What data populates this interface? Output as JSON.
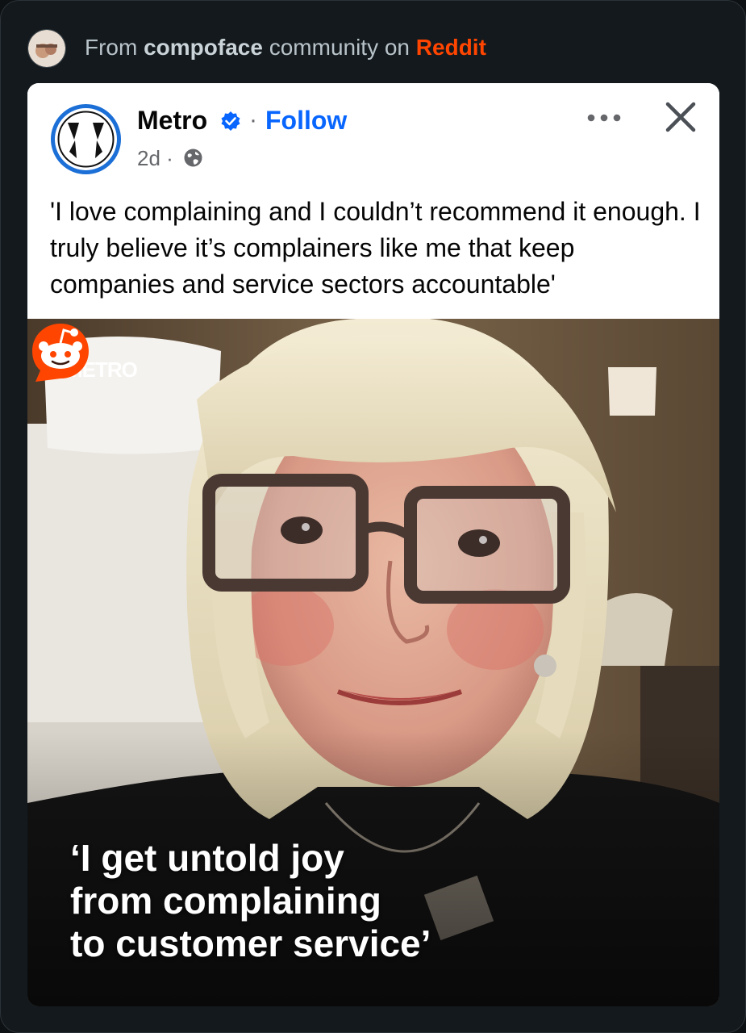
{
  "source": {
    "prefix": "From",
    "community": "compoface",
    "middle": "community on",
    "platform": "Reddit",
    "colors": {
      "platform": "#ff4500"
    }
  },
  "post": {
    "page_name": "Metro",
    "separator": "·",
    "follow_label": "Follow",
    "time": "2d ·",
    "icons": [
      "metro-logo",
      "verified-badge-icon",
      "globe-icon",
      "more-options-icon",
      "close-icon"
    ],
    "caption": "'I love complaining and I couldn’t recommend it enough. I truly believe it’s complainers like me that keep companies and service sectors accountable'",
    "colors": {
      "follow": "#0866ff",
      "verified": "#0866ff"
    }
  },
  "image": {
    "watermark": "METRO",
    "headline_lines": [
      "‘I get untold joy",
      "from complaining",
      "to customer service’"
    ],
    "badge_icon": "reddit-snoo-icon"
  }
}
